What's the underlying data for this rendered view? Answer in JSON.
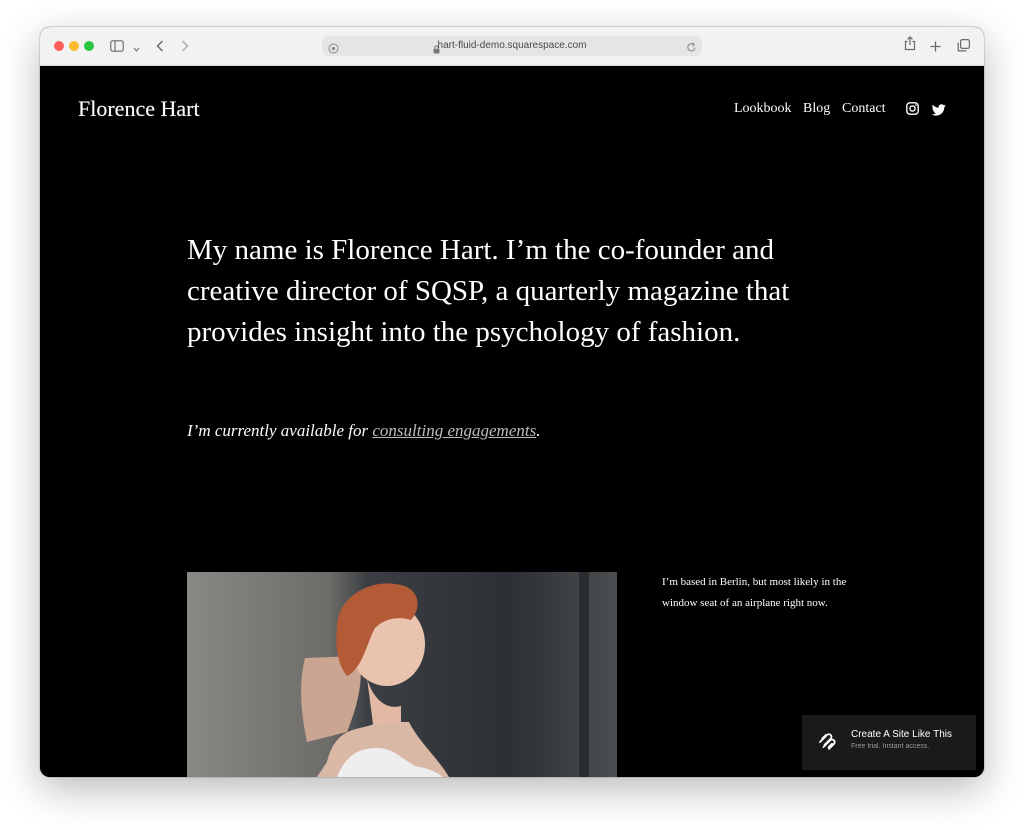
{
  "browser": {
    "url": "hart-fluid-demo.squarespace.com",
    "colors": {
      "close": "#fe5f57",
      "minimize": "#febc2e",
      "maximize": "#28c840"
    },
    "icons": [
      "sidebar-icon",
      "chevron-down-icon",
      "back-icon",
      "forward-icon",
      "shield-icon",
      "lock-icon",
      "reload-icon",
      "share-icon",
      "new-tab-icon",
      "tabs-overview-icon"
    ]
  },
  "site": {
    "brand": "Florence Hart",
    "nav": [
      {
        "label": "Lookbook"
      },
      {
        "label": "Blog"
      },
      {
        "label": "Contact"
      }
    ],
    "social": [
      "instagram-icon",
      "twitter-icon"
    ],
    "hero_text": "My name is Florence Hart. I’m the co-founder and creative director of SQSP, a quarterly magazine that provides insight into the psychology of fashion.",
    "availability": {
      "prefix": "I’m currently available for ",
      "link": "consulting engagements",
      "suffix": "."
    },
    "side_text": "I’m based in Berlin, but most likely in the window seat of an airplane right now."
  },
  "badge": {
    "title": "Create A Site Like This",
    "subtitle": "Free trial. Instant access."
  }
}
